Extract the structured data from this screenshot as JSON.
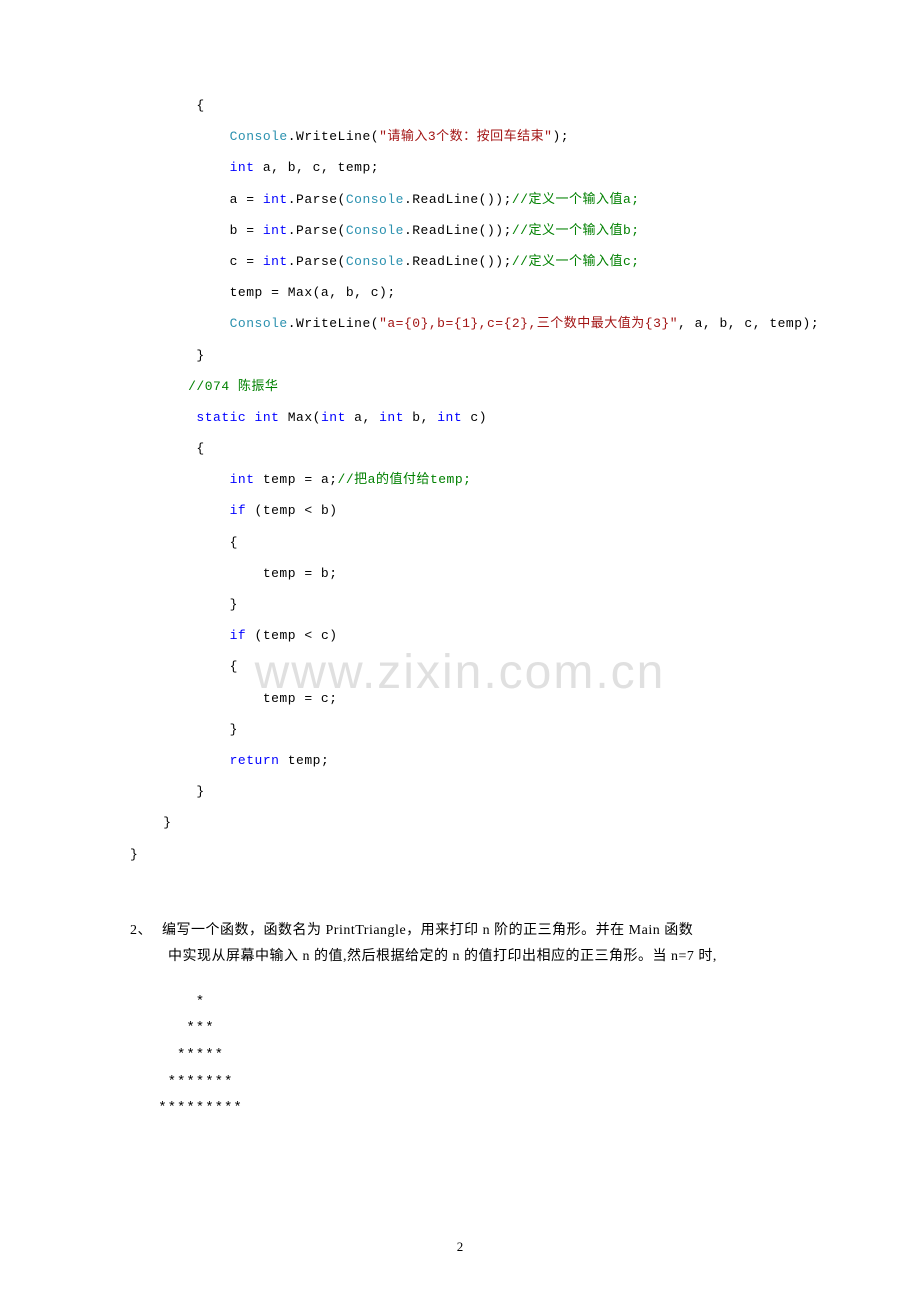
{
  "code": {
    "line1_brace": "        {",
    "line2a": "            ",
    "line2_cls": "Console",
    "line2b": ".WriteLine(",
    "line2_str": "\"请输入3个数：按回车结束\"",
    "line2c": ");",
    "line3a": "            ",
    "line3_kw": "int",
    "line3b": " a, b, c, temp;",
    "line4a": "            a = ",
    "line4_kw": "int",
    "line4b": ".Parse(",
    "line4_cls": "Console",
    "line4c": ".ReadLine());",
    "line4_cmt": "//定义一个输入值a;",
    "line5a": "            b = ",
    "line5_kw": "int",
    "line5b": ".Parse(",
    "line5_cls": "Console",
    "line5c": ".ReadLine());",
    "line5_cmt": "//定义一个输入值b;",
    "line6a": "            c = ",
    "line6_kw": "int",
    "line6b": ".Parse(",
    "line6_cls": "Console",
    "line6c": ".ReadLine());",
    "line6_cmt": "//定义一个输入值c;",
    "line7": "            temp = Max(a, b, c);",
    "line8a": "            ",
    "line8_cls": "Console",
    "line8b": ".WriteLine(",
    "line8_str": "\"a={0},b={1},c={2},三个数中最大值为{3}\"",
    "line8c": ", a, b, c, temp);",
    "line9": "        }",
    "line10a": "       ",
    "line10_cmt": "//074 陈振华",
    "line11a": "        ",
    "line11_kw1": "static",
    "line11b": " ",
    "line11_kw2": "int",
    "line11c": " Max(",
    "line11_kw3": "int",
    "line11d": " a, ",
    "line11_kw4": "int",
    "line11e": " b, ",
    "line11_kw5": "int",
    "line11f": " c)",
    "line12": "        {",
    "line13a": "            ",
    "line13_kw": "int",
    "line13b": " temp = a;",
    "line13_cmt": "//把a的值付给temp;",
    "line14a": "            ",
    "line14_kw": "if",
    "line14b": " (temp < b)",
    "line15": "            {",
    "line16": "                temp = b;",
    "line17": "            }",
    "line18a": "            ",
    "line18_kw": "if",
    "line18b": " (temp < c)",
    "line19": "            {",
    "line20": "                temp = c;",
    "line21": "            }",
    "line22a": "            ",
    "line22_kw": "return",
    "line22b": " temp;",
    "line23": "        }",
    "line24": "    }",
    "line25": "}"
  },
  "question": {
    "number": "2、",
    "line1": "编写一个函数，函数名为 PrintTriangle，用来打印 n 阶的正三角形。并在 Main 函数",
    "line2": "中实现从屏幕中输入 n 的值,然后根据给定的 n 的值打印出相应的正三角形。当 n=7 时,"
  },
  "triangle": {
    "row1": "       *",
    "row2": "      ***",
    "row3": "     *****",
    "row4": "    *******",
    "row5": "   *********"
  },
  "watermark": "www.zixin.com.cn",
  "pageNumber": "2"
}
